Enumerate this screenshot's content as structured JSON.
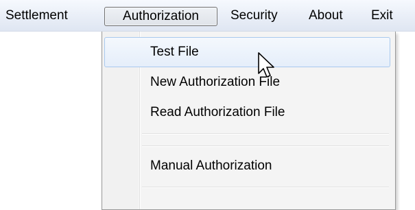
{
  "menubar": {
    "items": [
      {
        "label": "Settlement"
      },
      {
        "label": "Authorization",
        "active": true
      },
      {
        "label": "Security"
      },
      {
        "label": "About"
      },
      {
        "label": "Exit"
      }
    ]
  },
  "dropdown": {
    "items": [
      {
        "label": "Test File",
        "highlighted": true
      },
      {
        "label": "New Authorization File"
      },
      {
        "label": "Read Authorization File"
      },
      {
        "label": "Manual Authorization"
      }
    ]
  },
  "colors": {
    "menubar_top": "#f6f9fe",
    "menubar_bottom": "#dfe6f2",
    "highlight_border": "#a8c9ee",
    "highlight_fill": "#e5eefa",
    "dropdown_bg": "#f4f4f4"
  },
  "cursor": {
    "icon": "arrow-pointer-icon"
  }
}
